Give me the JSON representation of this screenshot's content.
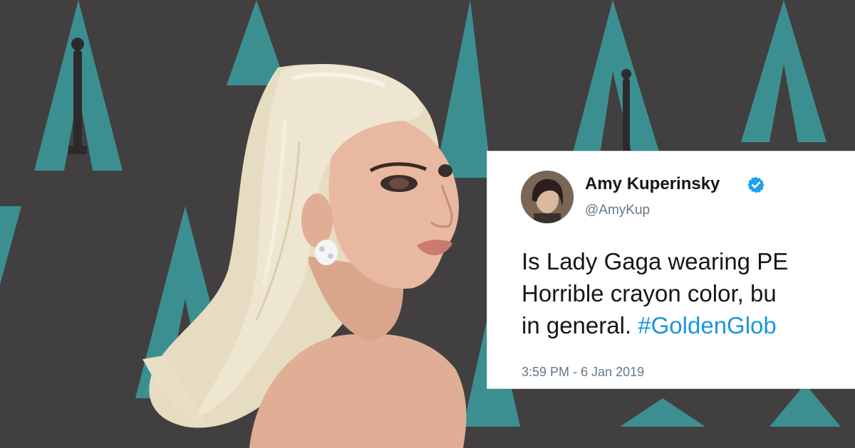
{
  "photo": {
    "subject": "woman-with-platinum-hair"
  },
  "tweet": {
    "display_name": "Amy Kuperinsky",
    "handle": "@AmyKup",
    "verified_icon": "verified-badge-icon",
    "line1": "Is Lady Gaga wearing PE",
    "line2": "Horrible crayon color, bu",
    "line3_text": "in general. ",
    "line3_hashtag": "#GoldenGlob",
    "timestamp": "3:59 PM - 6 Jan 2019"
  },
  "colors": {
    "backdrop_grey": "#403d3f",
    "backdrop_teal": "#3c8f91",
    "hashtag_blue": "#1b95e0",
    "verified_blue": "#1da1f2",
    "hair_blonde": "#e9e0c8",
    "skin": "#e2b49c"
  }
}
